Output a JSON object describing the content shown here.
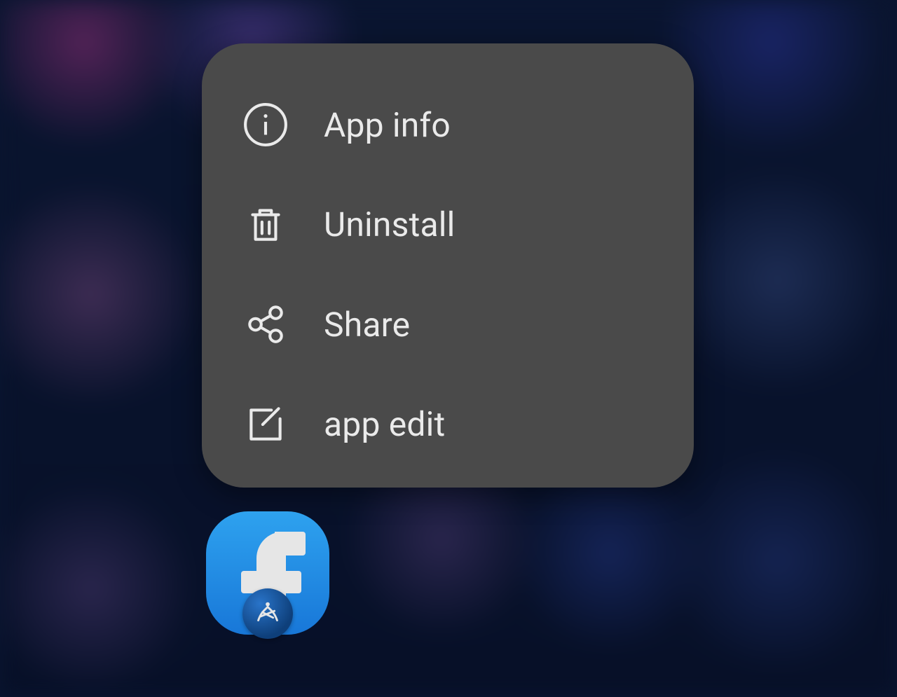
{
  "contextMenu": {
    "items": [
      {
        "label": "App info",
        "icon": "info-icon"
      },
      {
        "label": "Uninstall",
        "icon": "trash-icon"
      },
      {
        "label": "Share",
        "icon": "share-icon"
      },
      {
        "label": "app edit",
        "icon": "edit-icon"
      }
    ]
  },
  "app": {
    "name": "Facebook",
    "iconPrimaryColor": "#1877d8",
    "iconSecondaryColor": "#2ea2ef",
    "badge": "app-cloner-badge"
  },
  "colors": {
    "menuBackground": "#4a4a4a",
    "menuText": "#eaeaea"
  }
}
